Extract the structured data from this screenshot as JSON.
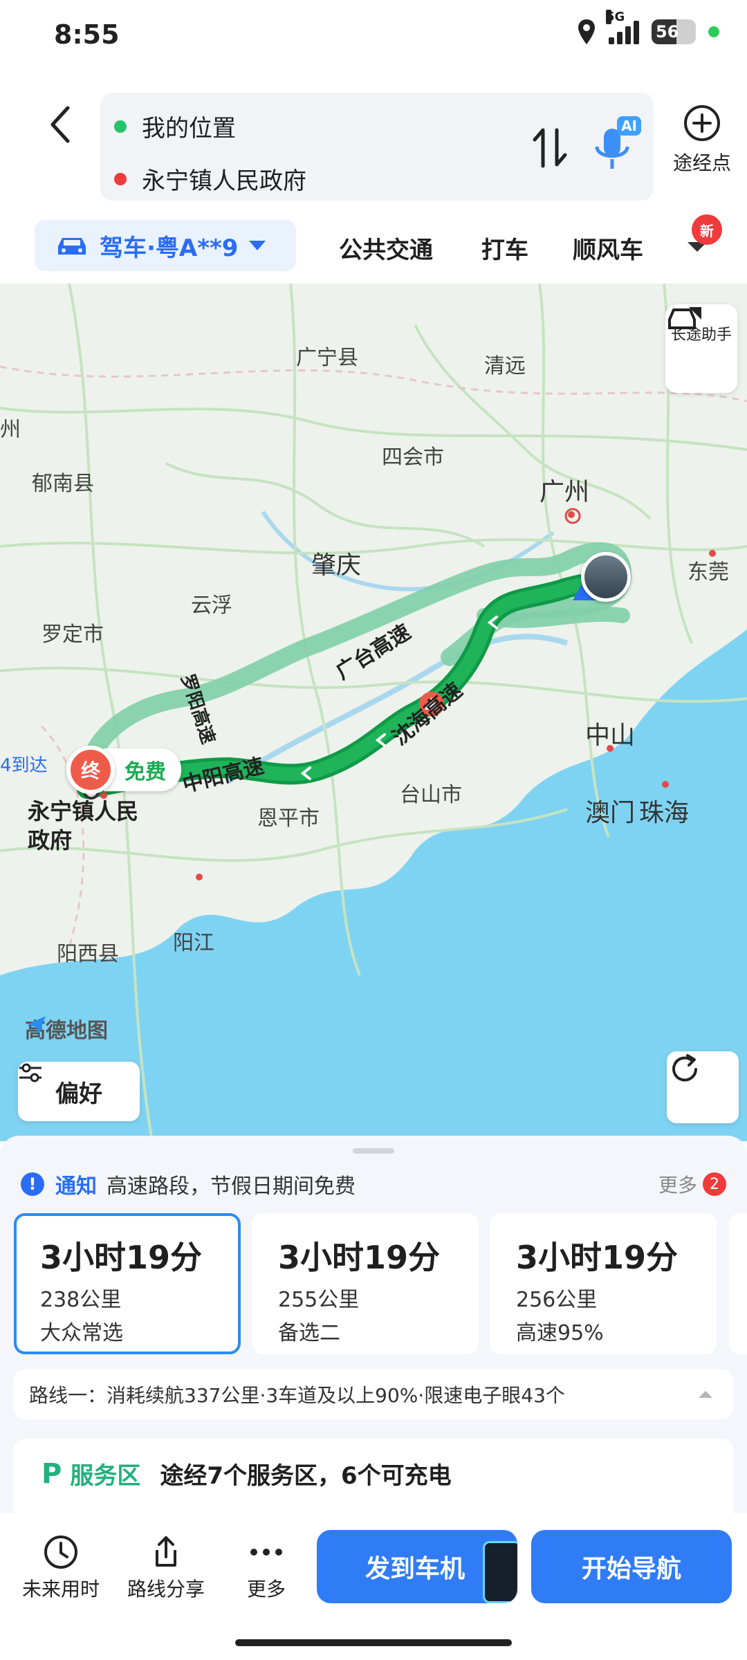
{
  "status_bar": {
    "time": "8:55",
    "network": "5G",
    "battery": "56"
  },
  "header": {
    "start": "我的位置",
    "destination": "永宁镇人民政府",
    "ai_badge": "AI",
    "waypoint_label": "途经点"
  },
  "modes": {
    "drive_label": "驾车·粤A**9",
    "tabs": [
      "公共交通",
      "打车",
      "顺风车"
    ],
    "new_badge": "新"
  },
  "map": {
    "labels": [
      {
        "text": "广宁县"
      },
      {
        "text": "清远"
      },
      {
        "text": "四会市"
      },
      {
        "text": "广州"
      },
      {
        "text": "郁南县"
      },
      {
        "text": "肇庆"
      },
      {
        "text": "云浮"
      },
      {
        "text": "东莞"
      },
      {
        "text": "罗定市"
      },
      {
        "text": "中山"
      },
      {
        "text": "台山市"
      },
      {
        "text": "恩平市"
      },
      {
        "text": "澳门"
      },
      {
        "text": "珠海"
      },
      {
        "text": "阳西县"
      },
      {
        "text": "阳江"
      },
      {
        "text": "州"
      }
    ],
    "road_labels": [
      "广台高速",
      "沈海高速",
      "中阳高速",
      "罗阳高速"
    ],
    "long_trip_label": "长途助手",
    "end_marker": "终",
    "free_tag": "免费",
    "arrive_label": "4到达",
    "destination_name": "永宁镇人民政府",
    "logo_text": "高德地图",
    "preference_label": "偏好",
    "colors": {
      "route_main": "#1fb35a",
      "route_alt": "#7fcfa8",
      "sea": "#7fd3f2"
    }
  },
  "panel": {
    "notice_tag": "通知",
    "notice_text": "高速路段，节假日期间免费",
    "notice_more": "更多",
    "notice_count": "2",
    "routes": [
      {
        "time": "3小时19分",
        "distance": "238公里",
        "tag": "大众常选"
      },
      {
        "time": "3小时19分",
        "distance": "255公里",
        "tag": "备选二"
      },
      {
        "time": "3小时19分",
        "distance": "256公里",
        "tag": "高速95%"
      }
    ],
    "summary": "路线一：消耗续航337公里·3车道及以上90%·限速电子眼43个",
    "service_label": "服务区",
    "service_text": "途经7个服务区，6个可充电"
  },
  "bottom_bar": {
    "future_time": "未来用时",
    "share": "路线分享",
    "more": "更多",
    "send_to_car": "发到车机",
    "start_nav": "开始导航"
  }
}
